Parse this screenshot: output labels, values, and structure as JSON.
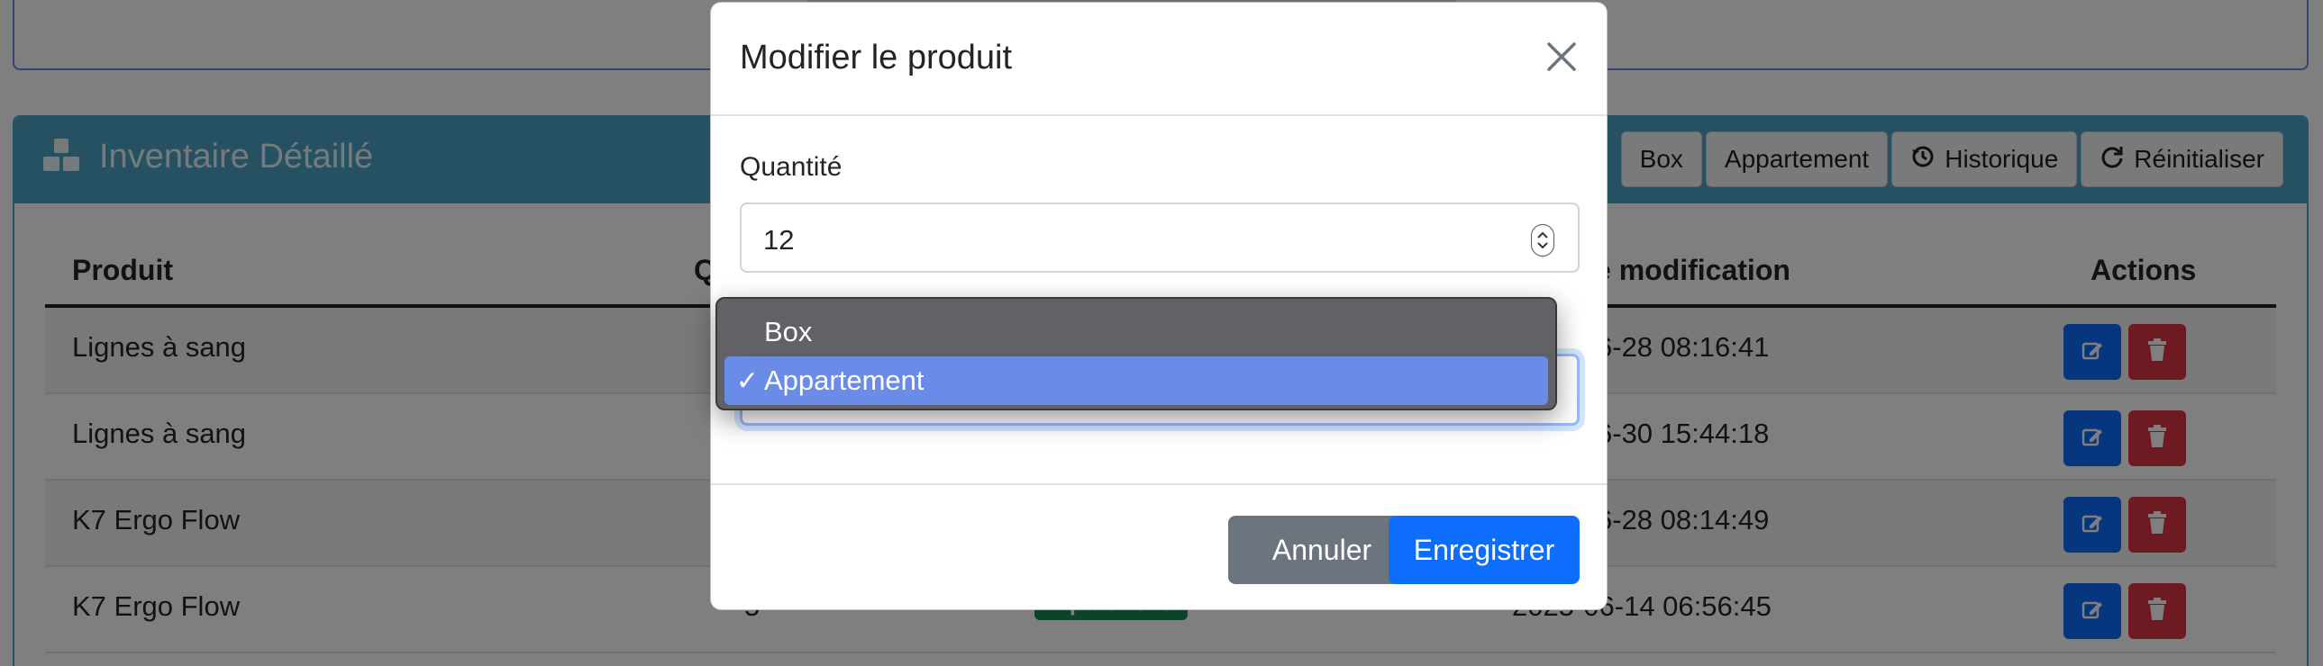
{
  "inventory": {
    "title": "Inventaire Détaillé",
    "filters": [
      "Box",
      "Appartement"
    ],
    "history_label": "Historique",
    "reset_label": "Réinitialiser",
    "columns": [
      "Produit",
      "Qu",
      "e modification",
      "Actions"
    ],
    "rows": [
      {
        "product": "Lignes à sang",
        "modified": "6-28 08:16:41"
      },
      {
        "product": "Lignes à sang",
        "modified": "6-30 15:44:18"
      },
      {
        "product": "K7 Ergo Flow",
        "modified": "6-28 08:14:49"
      },
      {
        "product": "K7 Ergo Flow",
        "quantity": "5",
        "badge": "Apartment",
        "modified": "2025-06-14 06:56:45"
      }
    ]
  },
  "modal": {
    "title": "Modifier le produit",
    "quantity_label": "Quantité",
    "quantity_value": "12",
    "cancel_label": "Annuler",
    "save_label": "Enregistrer"
  },
  "dropdown": {
    "options": [
      "Box",
      "Appartement"
    ],
    "selected": "Appartement",
    "check": "✓"
  },
  "colors": {
    "primary": "#0d6efd",
    "danger": "#dc3545",
    "secondary": "#6c757d",
    "info_header": "#4da3c7",
    "success": "#198754"
  }
}
